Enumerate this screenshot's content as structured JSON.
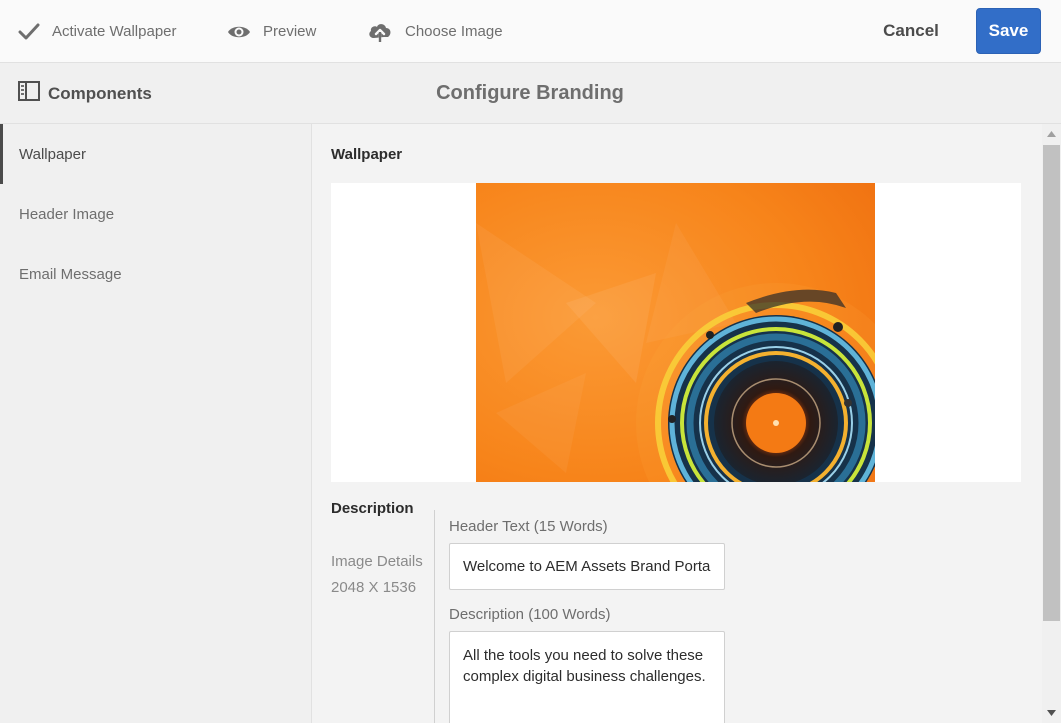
{
  "toolbar": {
    "activate_label": "Activate Wallpaper",
    "activate_icon": "checkmark-icon",
    "preview_label": "Preview",
    "preview_icon": "eye-icon",
    "choose_label": "Choose Image",
    "choose_icon": "cloud-upload-icon",
    "cancel_label": "Cancel",
    "save_label": "Save",
    "save_color": "#326ec8"
  },
  "header": {
    "components_label": "Components",
    "components_icon": "rail-panel-icon",
    "page_title": "Configure Branding"
  },
  "sidebar": {
    "items": [
      {
        "label": "Wallpaper",
        "active": true
      },
      {
        "label": "Header Image",
        "active": false
      },
      {
        "label": "Email Message",
        "active": false
      }
    ]
  },
  "main": {
    "section_title": "Wallpaper",
    "description_title": "Description",
    "image_details_label": "Image Details",
    "image_details_value": "2048 X 1536",
    "header_text_label": "Header Text (15 Words)",
    "header_text_value": "Welcome to AEM Assets Brand Portal",
    "description_label": "Description (100 Words)",
    "description_value": "All the tools you need to solve these complex digital business challenges."
  }
}
